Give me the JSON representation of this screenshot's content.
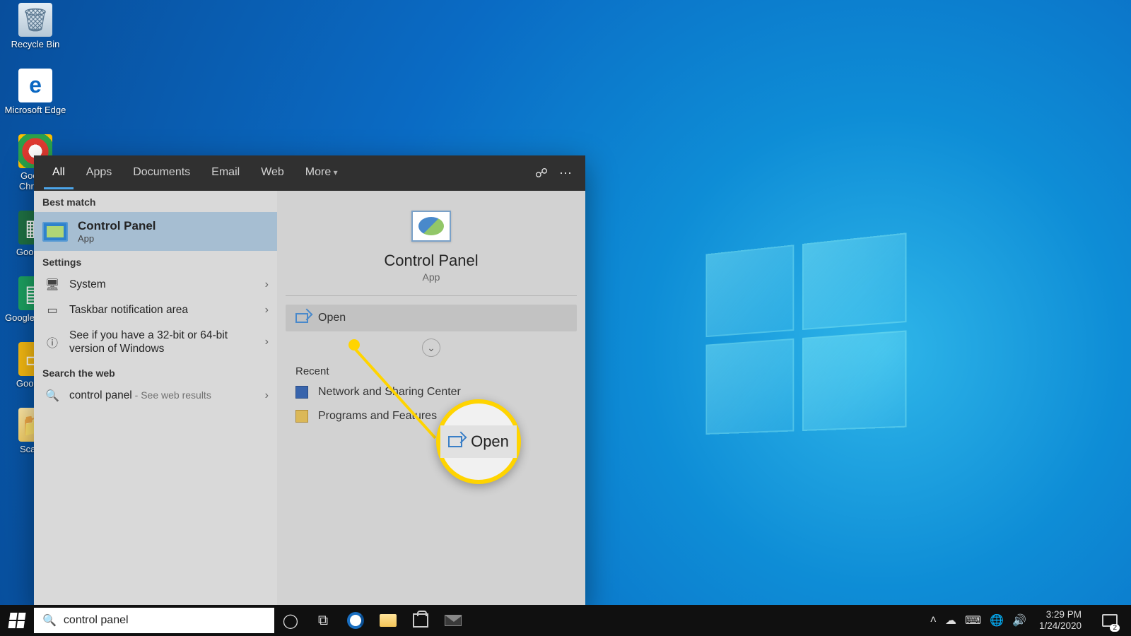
{
  "desktop_icons": {
    "recycle_bin": "Recycle Bin",
    "edge": "Microsoft Edge",
    "chrome": "Google Chrome",
    "excel": "Google E",
    "sheets": "Google Sheets",
    "slides": "Google S",
    "scanned": "Scanne"
  },
  "search_panel": {
    "tabs": {
      "all": "All",
      "apps": "Apps",
      "documents": "Documents",
      "email": "Email",
      "web": "Web",
      "more": "More"
    },
    "left": {
      "best_match_label": "Best match",
      "best_match_title": "Control Panel",
      "best_match_sub": "App",
      "settings_label": "Settings",
      "system": "System",
      "taskbar_notif": "Taskbar notification area",
      "bit_check": "See if you have a 32-bit or 64-bit version of Windows",
      "search_web_label": "Search the web",
      "search_web_term": "control panel",
      "search_web_hint": " - See web results"
    },
    "right": {
      "hero_title": "Control Panel",
      "hero_sub": "App",
      "open_label": "Open",
      "recent_label": "Recent",
      "recent1": "Network and Sharing Center",
      "recent2": "Programs and Features"
    }
  },
  "callout": {
    "zoom_label": "Open"
  },
  "taskbar": {
    "search_value": "control panel",
    "time": "3:29 PM",
    "date": "1/24/2020",
    "notif_count": "2"
  }
}
